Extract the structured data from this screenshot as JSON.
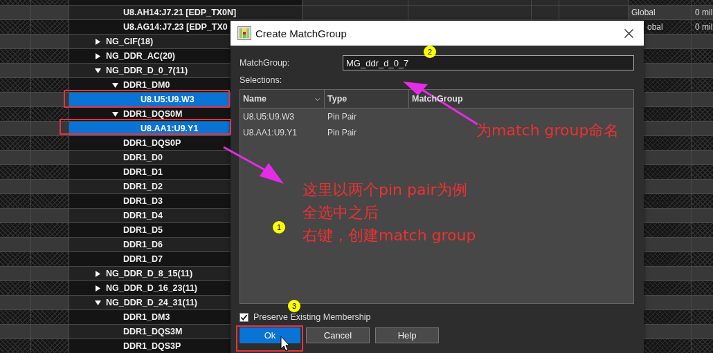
{
  "tree": [
    {
      "children": [
        {
          "label": "U8.AH14:J7.21 [EDP_TX0N]",
          "selected": false,
          "cells": [
            {
              "text": "Global"
            },
            {
              "text": "0 mil"
            }
          ]
        },
        {
          "label": "U8.AG14:J7.23 [EDP_TX0",
          "selected": false,
          "cells": [
            {
              "text": "obal",
              "cut": true
            },
            {
              "text": "0 mil"
            }
          ]
        }
      ]
    },
    {
      "label": "NG_CIF(18)",
      "expanded": false,
      "selected": false
    },
    {
      "label": "NG_DDR_AC(20)",
      "expanded": false,
      "selected": false
    },
    {
      "label": "NG_DDR_D_0_7(11)",
      "expanded": true,
      "selected": false,
      "children": [
        {
          "label": "DDR1_DM0",
          "expanded": true,
          "selected": false,
          "children": [
            {
              "label": "U8.U5:U9.W3",
              "selected": true
            }
          ]
        },
        {
          "label": "DDR1_DQS0M",
          "expanded": true,
          "selected": false,
          "children": [
            {
              "label": "U8.AA1:U9.Y1",
              "selected": true
            }
          ]
        },
        {
          "label": "DDR1_DQS0P",
          "selected": false
        },
        {
          "label": "DDR1_D0",
          "selected": false
        },
        {
          "label": "DDR1_D1",
          "selected": false
        },
        {
          "label": "DDR1_D2",
          "selected": false
        },
        {
          "label": "DDR1_D3",
          "selected": false
        },
        {
          "label": "DDR1_D4",
          "selected": false
        },
        {
          "label": "DDR1_D5",
          "selected": false
        },
        {
          "label": "DDR1_D6",
          "selected": false
        },
        {
          "label": "DDR1_D7",
          "selected": false
        }
      ]
    },
    {
      "label": "NG_DDR_D_8_15(11)",
      "expanded": false,
      "selected": false
    },
    {
      "label": "NG_DDR_D_16_23(11)",
      "expanded": false,
      "selected": false
    },
    {
      "label": "NG_DDR_D_24_31(11)",
      "expanded": true,
      "selected": false,
      "children": [
        {
          "label": "DDR1_DM3",
          "selected": false
        },
        {
          "label": "DDR1_DQS3M",
          "selected": false
        },
        {
          "label": "DDR1_DQS3P",
          "selected": false
        }
      ]
    }
  ],
  "dialog": {
    "title": "Create MatchGroup",
    "name_label": "MatchGroup:",
    "name_value": "MG_ddr_d_0_7",
    "selections_label": "Selections:",
    "columns": [
      "Name",
      "Type",
      "MatchGroup"
    ],
    "rows": [
      {
        "name": "U8.U5:U9.W3",
        "type": "Pin Pair"
      },
      {
        "name": "U8.AA1:U9.Y1",
        "type": "Pin Pair"
      }
    ],
    "preserve": {
      "label": "Preserve Existing Membership",
      "checked": true
    },
    "buttons": [
      {
        "label": "Ok",
        "default": true
      },
      {
        "label": "Cancel",
        "default": false
      },
      {
        "label": "Help",
        "default": false
      }
    ]
  },
  "annotations": {
    "markers": [
      "1",
      "2",
      "3"
    ],
    "notes": [
      {
        "lines": [
          "为match group命名"
        ]
      },
      {
        "lines": [
          "这里以两个pin pair为例",
          "全选中之后",
          "右键，创建match group"
        ]
      }
    ]
  }
}
